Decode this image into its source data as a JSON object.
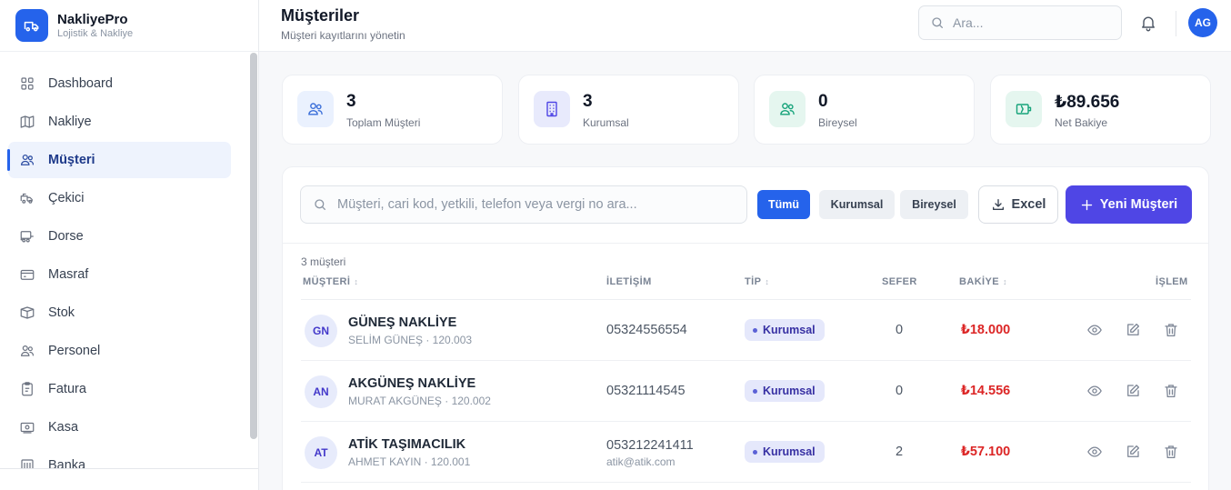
{
  "brand": {
    "name": "NakliyePro",
    "subtitle": "Lojistik & Nakliye",
    "logo_icon": "truck-icon"
  },
  "sidebar": {
    "items": [
      {
        "label": "Dashboard",
        "icon": "grid-icon",
        "active": false
      },
      {
        "label": "Nakliye",
        "icon": "map-icon",
        "active": false
      },
      {
        "label": "Müşteri",
        "icon": "users-icon",
        "active": true
      },
      {
        "label": "Çekici",
        "icon": "truck-icon",
        "active": false
      },
      {
        "label": "Dorse",
        "icon": "trailer-icon",
        "active": false
      },
      {
        "label": "Masraf",
        "icon": "receipt-icon",
        "active": false
      },
      {
        "label": "Stok",
        "icon": "box-icon",
        "active": false
      },
      {
        "label": "Personel",
        "icon": "users-icon",
        "active": false
      },
      {
        "label": "Fatura",
        "icon": "clipboard-icon",
        "active": false
      },
      {
        "label": "Kasa",
        "icon": "cash-icon",
        "active": false
      },
      {
        "label": "Banka",
        "icon": "bank-icon",
        "active": false
      }
    ]
  },
  "header": {
    "title": "Müşteriler",
    "subtitle": "Müşteri kayıtlarını yönetin",
    "search_placeholder": "Ara...",
    "avatar_initials": "AG"
  },
  "stats": [
    {
      "value": "3",
      "label": "Toplam Müşteri",
      "icon": "users-icon",
      "color": "#eaf1fe"
    },
    {
      "value": "3",
      "label": "Kurumsal",
      "icon": "building-icon",
      "color": "#e8eafc"
    },
    {
      "value": "0",
      "label": "Bireysel",
      "icon": "users-icon",
      "color": "#e5f6ef"
    },
    {
      "value": "₺89.656",
      "label": "Net Bakiye",
      "icon": "wallet-icon",
      "color": "#e5f6ef"
    }
  ],
  "filters": {
    "search_placeholder": "Müşteri, cari kod, yetkili, telefon veya vergi no ara...",
    "chips": [
      "Tümü",
      "Kurumsal",
      "Bireysel"
    ],
    "active_chip": "Tümü",
    "excel_label": "Excel",
    "new_label": "Yeni Müşteri"
  },
  "table": {
    "count_label": "3 müşteri",
    "columns": {
      "customer": "MÜŞTERİ",
      "contact": "İLETİŞİM",
      "type": "TİP",
      "trips": "SEFER",
      "balance": "BAKİYE",
      "action": "İŞLEM"
    },
    "rows": [
      {
        "initials": "GN",
        "name": "GÜNEŞ NAKLİYE",
        "sub": "SELİM GÜNEŞ · 120.003",
        "phone": "05324556554",
        "email": "",
        "type": "Kurumsal",
        "trips": "0",
        "balance": "₺18.000"
      },
      {
        "initials": "AN",
        "name": "AKGÜNEŞ NAKLİYE",
        "sub": "MURAT AKGÜNEŞ · 120.002",
        "phone": "05321114545",
        "email": "",
        "type": "Kurumsal",
        "trips": "0",
        "balance": "₺14.556"
      },
      {
        "initials": "AT",
        "name": "ATİK TAŞIMACILIK",
        "sub": "AHMET KAYIN · 120.001",
        "phone": "053212241411",
        "email": "atik@atik.com",
        "type": "Kurumsal",
        "trips": "2",
        "balance": "₺57.100"
      }
    ]
  },
  "colors": {
    "primary": "#2563eb",
    "accent": "#4f46e5",
    "negative": "#dc2626"
  }
}
